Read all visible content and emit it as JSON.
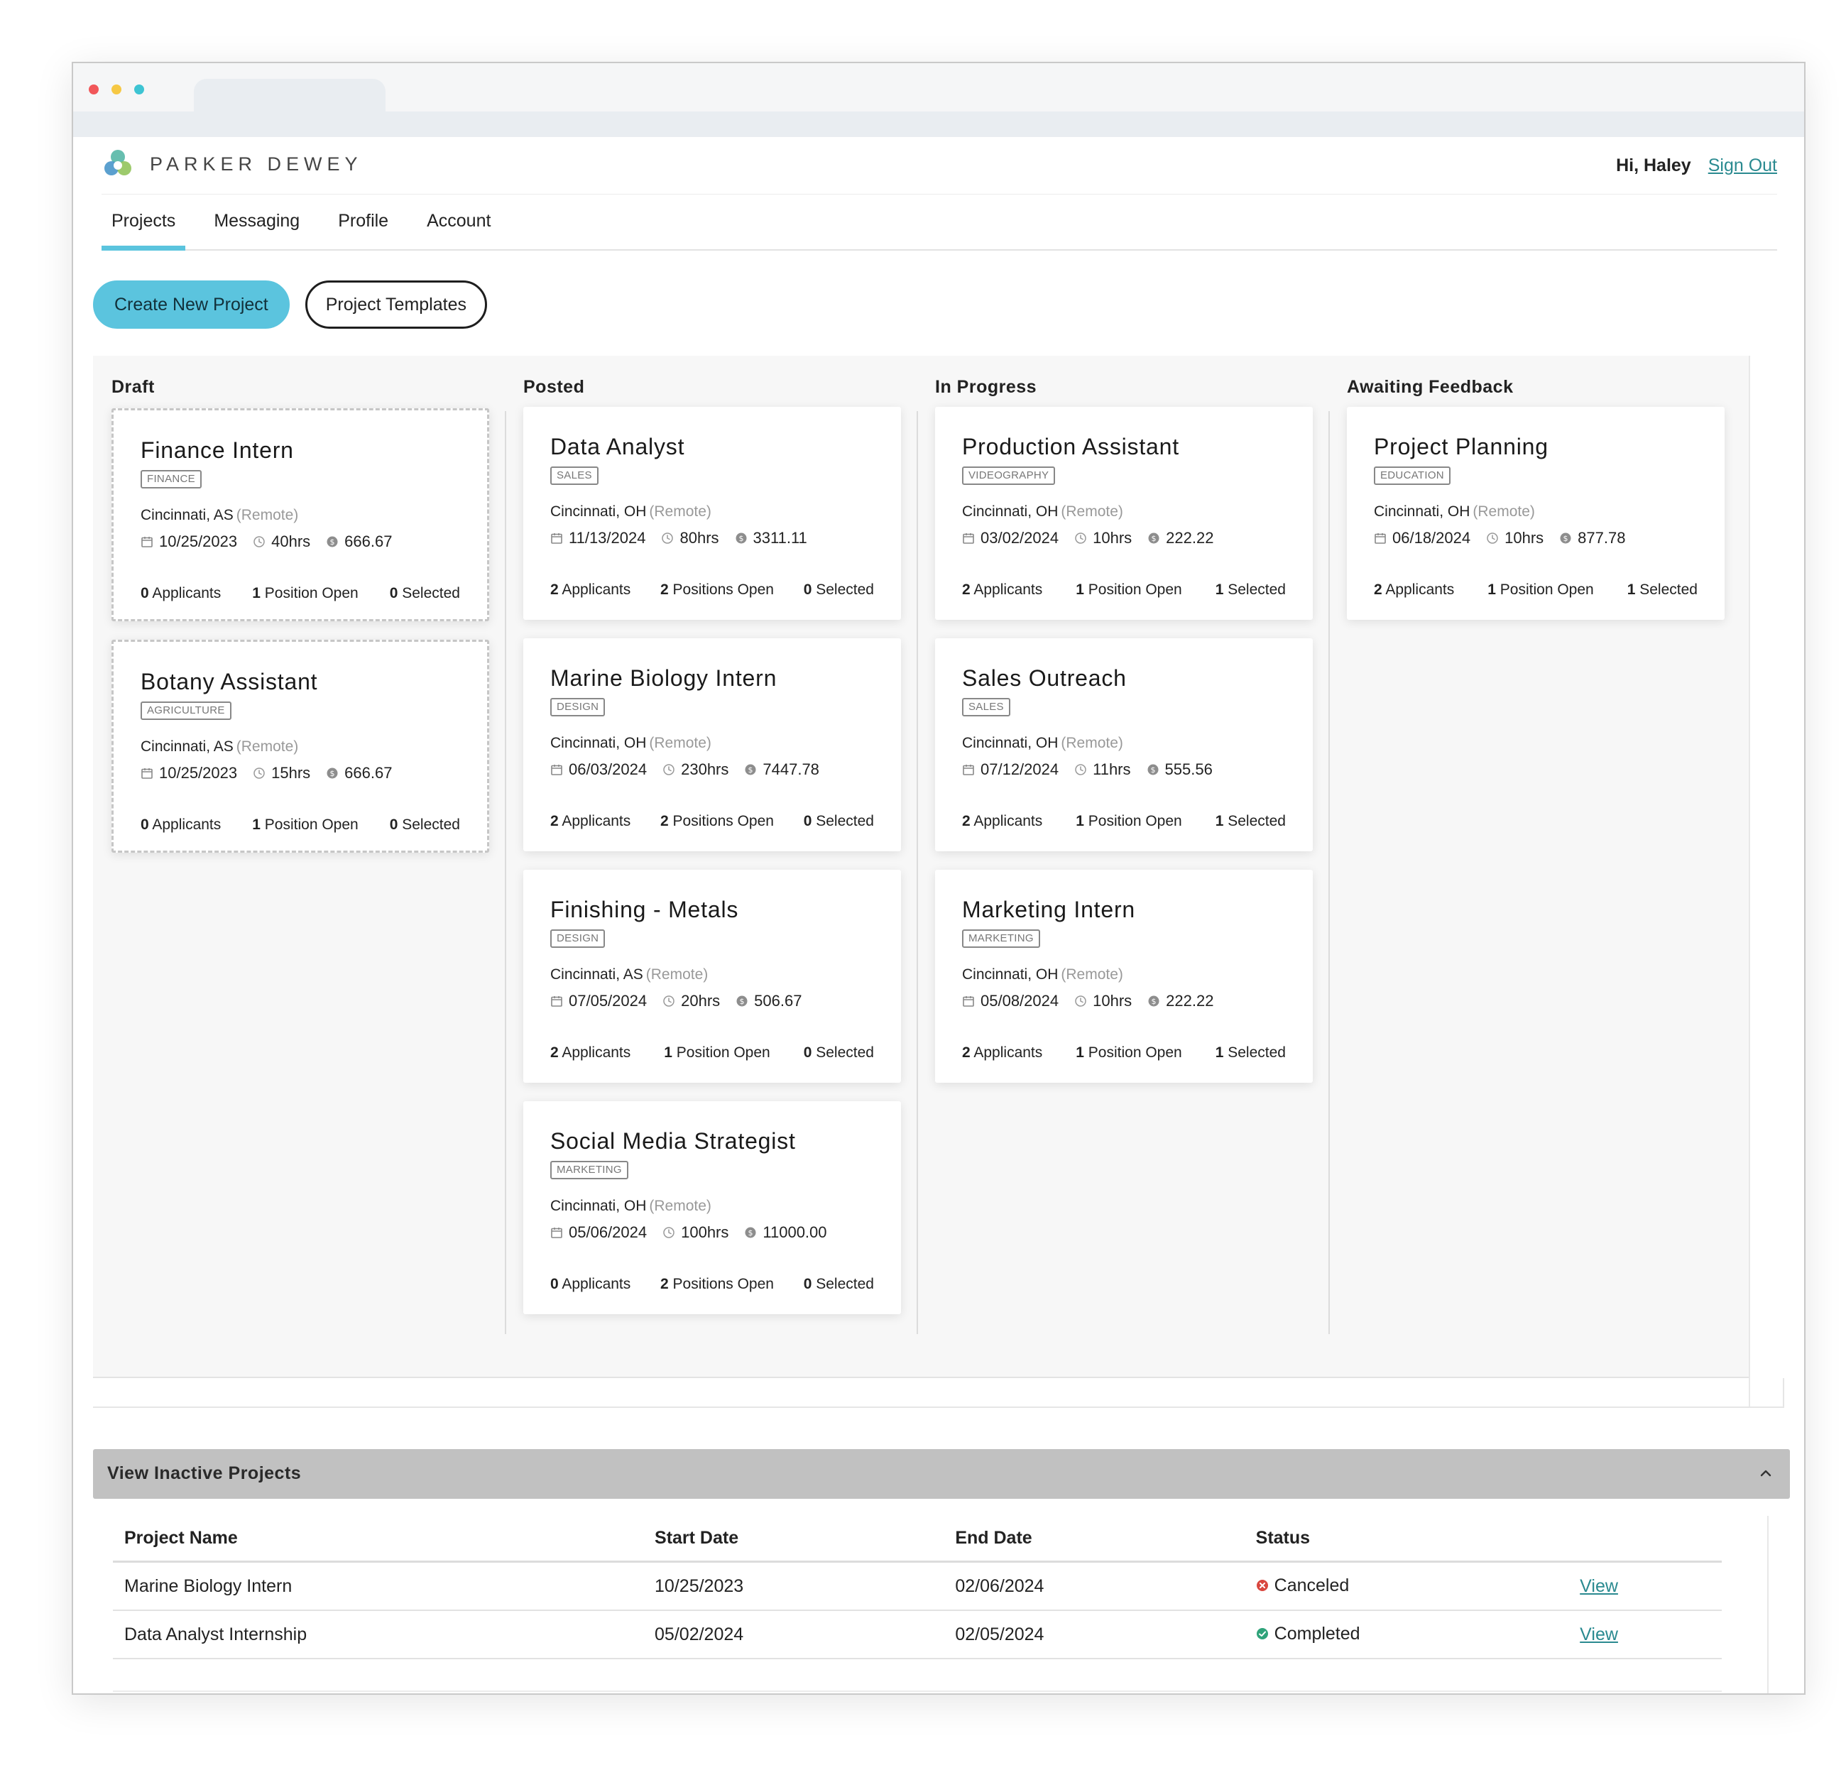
{
  "brand": {
    "name": "PARKER DEWEY"
  },
  "user": {
    "greeting": "Hi, Haley",
    "signout": "Sign Out"
  },
  "nav": [
    "Projects",
    "Messaging",
    "Profile",
    "Account"
  ],
  "buttons": {
    "create": "Create New Project",
    "templates": "Project Templates"
  },
  "columns": [
    {
      "title": "Draft",
      "cards": [
        {
          "title": "Finance Intern",
          "tag": "FINANCE",
          "location": "Cincinnati, AS",
          "remote": "(Remote)",
          "date": "10/25/2023",
          "hours": "40hrs",
          "pay": "666.67",
          "applicants": "0",
          "positions": "1",
          "positions_label": "Position Open",
          "selected": "0"
        },
        {
          "title": "Botany Assistant",
          "tag": "AGRICULTURE",
          "location": "Cincinnati, AS",
          "remote": "(Remote)",
          "date": "10/25/2023",
          "hours": "15hrs",
          "pay": "666.67",
          "applicants": "0",
          "positions": "1",
          "positions_label": "Position Open",
          "selected": "0"
        }
      ]
    },
    {
      "title": "Posted",
      "cards": [
        {
          "title": "Data Analyst",
          "tag": "SALES",
          "location": "Cincinnati, OH",
          "remote": "(Remote)",
          "date": "11/13/2024",
          "hours": "80hrs",
          "pay": "3311.11",
          "applicants": "2",
          "positions": "2",
          "positions_label": "Positions Open",
          "selected": "0"
        },
        {
          "title": "Marine Biology Intern",
          "tag": "DESIGN",
          "location": "Cincinnati, OH",
          "remote": "(Remote)",
          "date": "06/03/2024",
          "hours": "230hrs",
          "pay": "7447.78",
          "applicants": "2",
          "positions": "2",
          "positions_label": "Positions Open",
          "selected": "0"
        },
        {
          "title": "Finishing - Metals",
          "tag": "DESIGN",
          "location": "Cincinnati, AS",
          "remote": "(Remote)",
          "date": "07/05/2024",
          "hours": "20hrs",
          "pay": "506.67",
          "applicants": "2",
          "positions": "1",
          "positions_label": "Position Open",
          "selected": "0"
        },
        {
          "title": "Social Media Strategist",
          "tag": "MARKETING",
          "location": "Cincinnati, OH",
          "remote": "(Remote)",
          "date": "05/06/2024",
          "hours": "100hrs",
          "pay": "11000.00",
          "applicants": "0",
          "positions": "2",
          "positions_label": "Positions Open",
          "selected": "0"
        }
      ]
    },
    {
      "title": "In Progress",
      "cards": [
        {
          "title": "Production Assistant",
          "tag": "VIDEOGRAPHY",
          "location": "Cincinnati, OH",
          "remote": "(Remote)",
          "date": "03/02/2024",
          "hours": "10hrs",
          "pay": "222.22",
          "applicants": "2",
          "positions": "1",
          "positions_label": "Position Open",
          "selected": "1"
        },
        {
          "title": "Sales Outreach",
          "tag": "SALES",
          "location": "Cincinnati, OH",
          "remote": "(Remote)",
          "date": "07/12/2024",
          "hours": "11hrs",
          "pay": "555.56",
          "applicants": "2",
          "positions": "1",
          "positions_label": "Position Open",
          "selected": "1"
        },
        {
          "title": "Marketing Intern",
          "tag": "MARKETING",
          "location": "Cincinnati, OH",
          "remote": "(Remote)",
          "date": "05/08/2024",
          "hours": "10hrs",
          "pay": "222.22",
          "applicants": "2",
          "positions": "1",
          "positions_label": "Position Open",
          "selected": "1"
        }
      ]
    },
    {
      "title": "Awaiting Feedback",
      "cards": [
        {
          "title": "Project Planning",
          "tag": "EDUCATION",
          "location": "Cincinnati, OH",
          "remote": "(Remote)",
          "date": "06/18/2024",
          "hours": "10hrs",
          "pay": "877.78",
          "applicants": "2",
          "positions": "1",
          "positions_label": "Position Open",
          "selected": "1"
        }
      ]
    }
  ],
  "stat_labels": {
    "applicants": "Applicants",
    "selected": "Selected"
  },
  "inactive": {
    "title": "View Inactive Projects",
    "headers": [
      "Project Name",
      "Start Date",
      "End Date",
      "Status"
    ],
    "rows": [
      {
        "name": "Marine Biology Intern",
        "start": "10/25/2023",
        "end": "02/06/2024",
        "status": "Canceled",
        "status_color": "#d9473f",
        "action": "View"
      },
      {
        "name": "Data Analyst Internship",
        "start": "05/02/2024",
        "end": "02/05/2024",
        "status": "Completed",
        "status_color": "#2fa37a",
        "action": "View"
      }
    ]
  },
  "colors": {
    "accent": "#5bc4de",
    "link": "#2a8a90"
  },
  "icons": {
    "calendar": "calendar-icon",
    "clock": "clock-icon",
    "pay": "dollar-coin-icon",
    "collapse": "chevron-up-icon"
  }
}
